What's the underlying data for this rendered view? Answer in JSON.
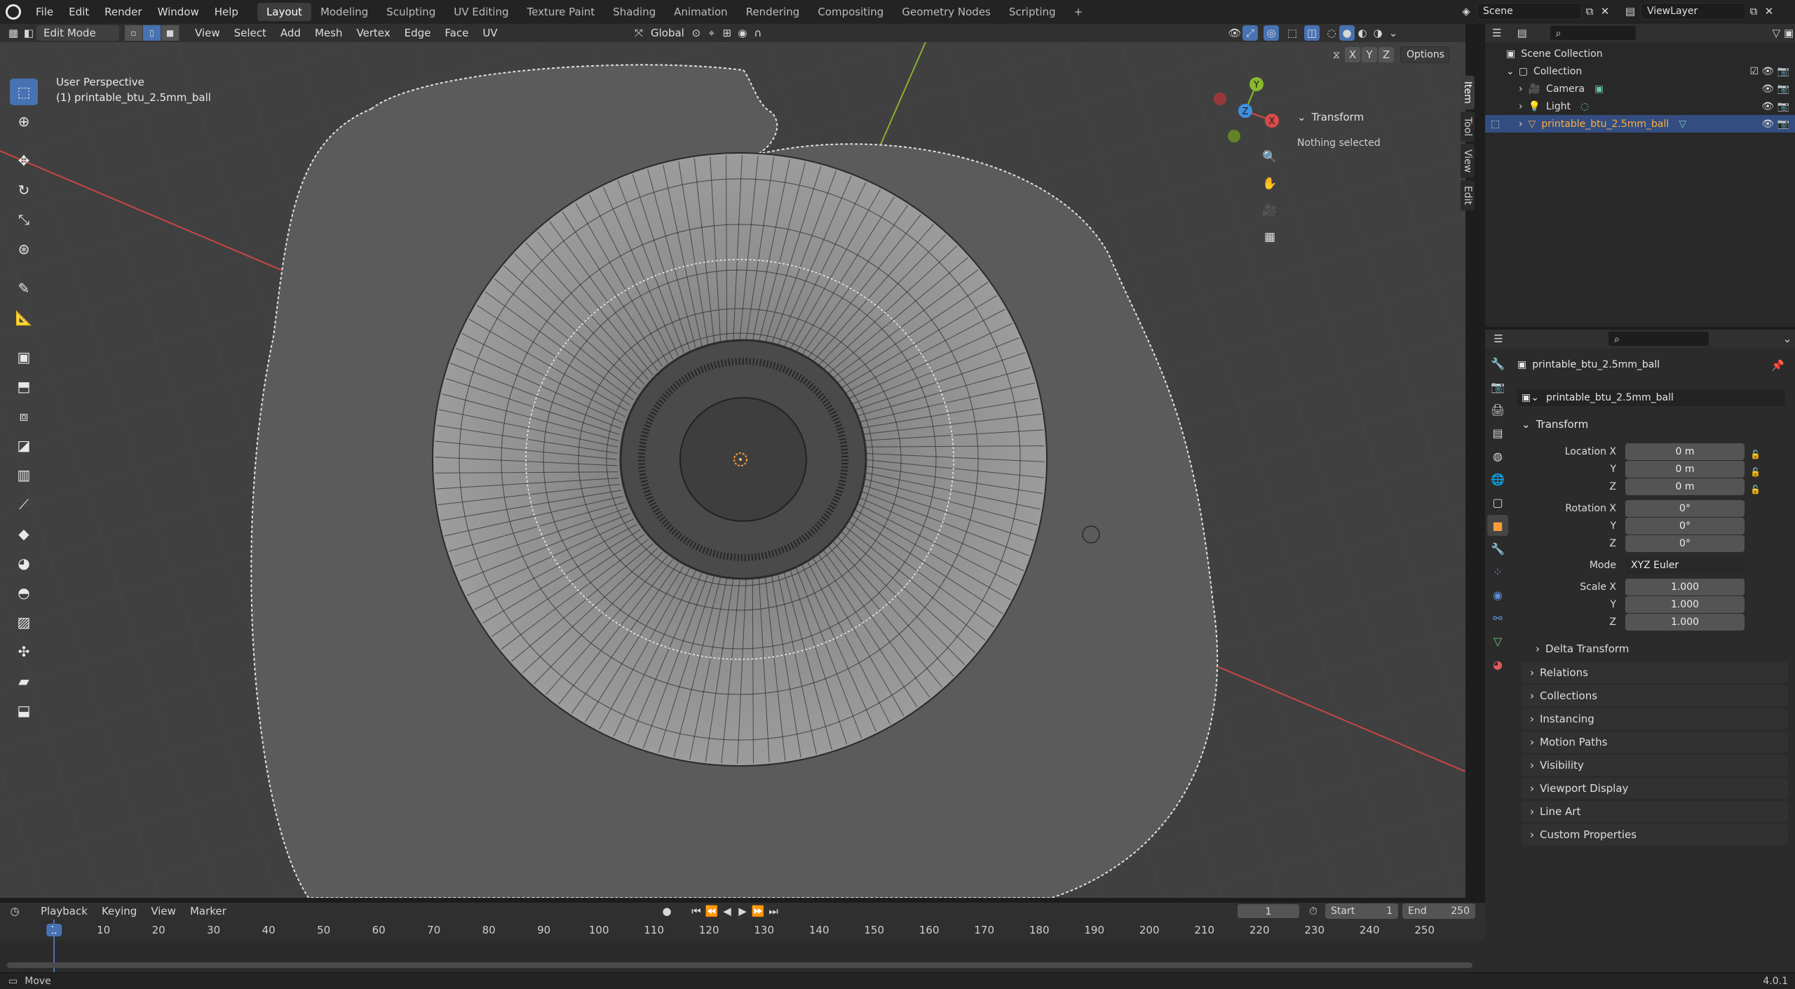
{
  "menu": {
    "file": "File",
    "edit": "Edit",
    "render": "Render",
    "window": "Window",
    "help": "Help"
  },
  "workspaces": [
    "Layout",
    "Modeling",
    "Sculpting",
    "UV Editing",
    "Texture Paint",
    "Shading",
    "Animation",
    "Rendering",
    "Compositing",
    "Geometry Nodes",
    "Scripting"
  ],
  "scene": {
    "name": "Scene",
    "view_layer": "ViewLayer"
  },
  "header": {
    "mode": "Edit Mode",
    "menus": [
      "View",
      "Select",
      "Add",
      "Mesh",
      "Vertex",
      "Edge",
      "Face",
      "UV"
    ],
    "transform_orientation": "Global",
    "options_label": "Options",
    "axes": [
      "X",
      "Y",
      "Z"
    ]
  },
  "viewport": {
    "perspective": "User Perspective",
    "object_label": "(1) printable_btu_2.5mm_ball",
    "gizmo": {
      "x": "X",
      "y": "Y",
      "z": "Z"
    }
  },
  "npanel": {
    "title": "Transform",
    "message": "Nothing selected",
    "tabs": [
      "Item",
      "Tool",
      "View",
      "Edit"
    ]
  },
  "outliner": {
    "root": "Scene Collection",
    "collection": "Collection",
    "items": [
      {
        "name": "Camera"
      },
      {
        "name": "Light"
      },
      {
        "name": "printable_btu_2.5mm_ball",
        "selected": true
      }
    ]
  },
  "properties": {
    "object_name": "printable_btu_2.5mm_ball",
    "datablock": "printable_btu_2.5mm_ball",
    "transform_title": "Transform",
    "location": {
      "label_x": "Location X",
      "label_y": "Y",
      "label_z": "Z",
      "x": "0 m",
      "y": "0 m",
      "z": "0 m"
    },
    "rotation": {
      "label_x": "Rotation X",
      "label_y": "Y",
      "label_z": "Z",
      "x": "0°",
      "y": "0°",
      "z": "0°"
    },
    "mode": {
      "label": "Mode",
      "value": "XYZ Euler"
    },
    "scale": {
      "label_x": "Scale X",
      "label_y": "Y",
      "label_z": "Z",
      "x": "1.000",
      "y": "1.000",
      "z": "1.000"
    },
    "delta": "Delta Transform",
    "panels": [
      "Relations",
      "Collections",
      "Instancing",
      "Motion Paths",
      "Visibility",
      "Viewport Display",
      "Line Art",
      "Custom Properties"
    ]
  },
  "timeline": {
    "menus": [
      "Playback",
      "Keying",
      "View",
      "Marker"
    ],
    "current_frame": "1",
    "start_label": "Start",
    "start": "1",
    "end_label": "End",
    "end": "250",
    "ticks": [
      "1",
      "10",
      "20",
      "30",
      "40",
      "50",
      "60",
      "70",
      "80",
      "90",
      "100",
      "110",
      "120",
      "130",
      "140",
      "150",
      "160",
      "170",
      "180",
      "190",
      "200",
      "210",
      "220",
      "230",
      "240",
      "250"
    ]
  },
  "status": {
    "action": "Move",
    "version": "4.0.1"
  },
  "colors": {
    "accent": "#4772b3",
    "x_axis": "#d94a4a",
    "y_axis": "#8ab82e",
    "z_axis": "#3d8fe0"
  }
}
